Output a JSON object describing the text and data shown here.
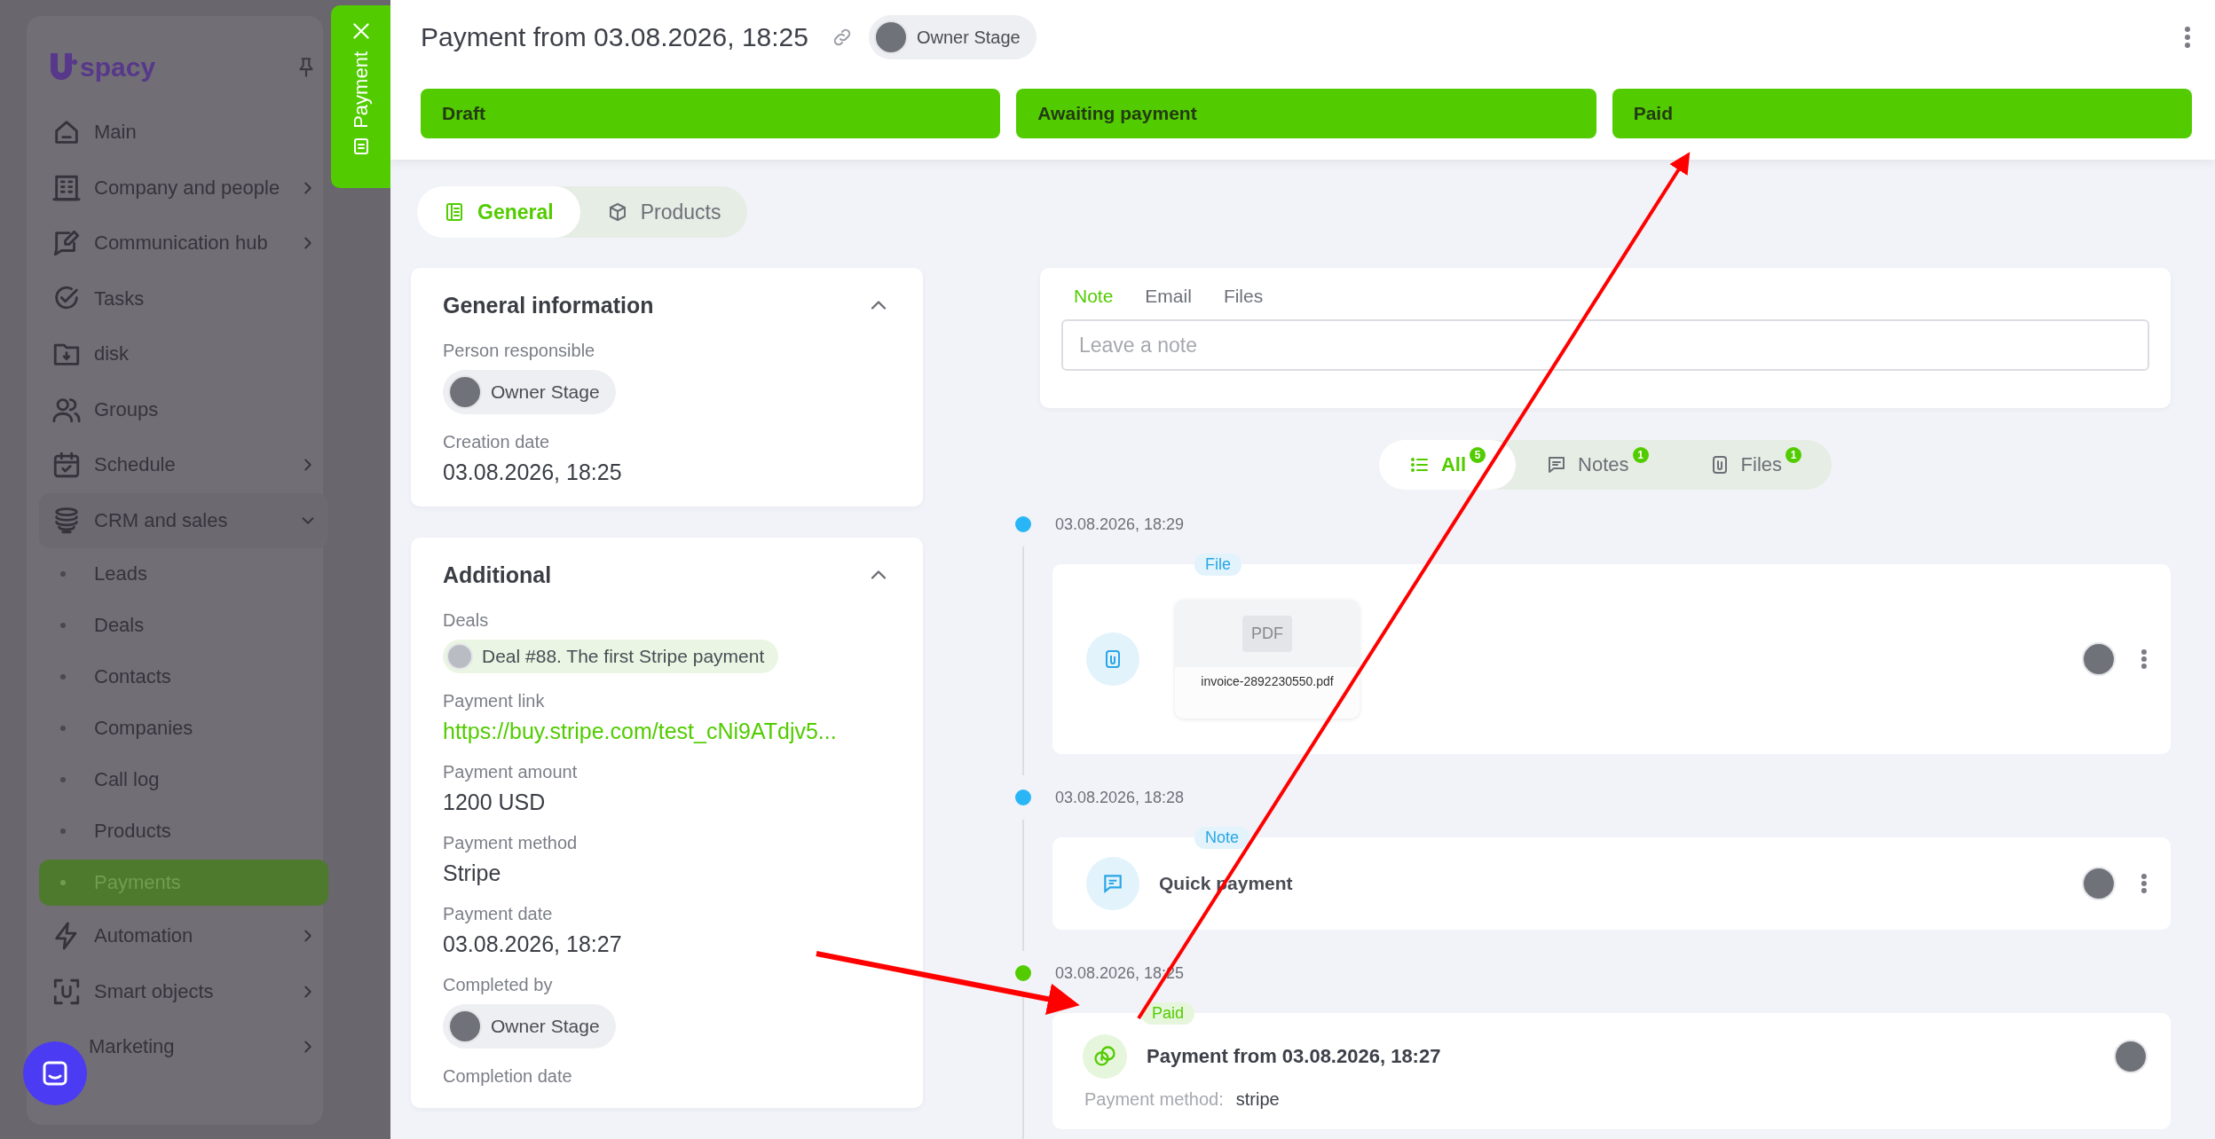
{
  "sidebar": {
    "logo": "spacy",
    "items": [
      {
        "label": "Main",
        "kind": "link",
        "selected": false
      },
      {
        "label": "Company and people",
        "kind": "group",
        "expanded": false,
        "selected": false
      },
      {
        "label": "Communication hub",
        "kind": "group",
        "expanded": false,
        "selected": false
      },
      {
        "label": "Tasks",
        "kind": "link",
        "selected": false
      },
      {
        "label": "disk",
        "kind": "link",
        "selected": false
      },
      {
        "label": "Groups",
        "kind": "link",
        "selected": false
      },
      {
        "label": "Schedule",
        "kind": "group",
        "expanded": false,
        "selected": false
      },
      {
        "label": "CRM and sales",
        "kind": "group",
        "expanded": true,
        "selected": false,
        "children": [
          {
            "label": "Leads",
            "selected": false
          },
          {
            "label": "Deals",
            "selected": false
          },
          {
            "label": "Contacts",
            "selected": false
          },
          {
            "label": "Companies",
            "selected": false
          },
          {
            "label": "Call log",
            "selected": false
          },
          {
            "label": "Products",
            "selected": false
          },
          {
            "label": "Payments",
            "selected": true
          }
        ]
      },
      {
        "label": "Automation",
        "kind": "group",
        "expanded": false,
        "selected": false
      },
      {
        "label": "Smart objects",
        "kind": "group",
        "expanded": false,
        "selected": false
      },
      {
        "label": "Marketing",
        "kind": "group",
        "expanded": false,
        "selected": false
      }
    ]
  },
  "panel_tab": {
    "label": "Payment"
  },
  "header": {
    "title": "Payment from 03.08.2026, 18:25",
    "owner": "Owner Stage",
    "stages": [
      {
        "label": "Draft",
        "reached": true
      },
      {
        "label": "Awaiting payment",
        "reached": true
      },
      {
        "label": "Paid",
        "reached": true
      }
    ]
  },
  "tabs": [
    {
      "label": "General",
      "selected": true
    },
    {
      "label": "Products",
      "selected": false
    }
  ],
  "cards": [
    {
      "title": "General information",
      "expanded": true,
      "fields": [
        {
          "label": "Person responsible",
          "value": "Owner Stage",
          "kind": "person"
        },
        {
          "label": "Creation date",
          "value": "03.08.2026, 18:25",
          "kind": "text"
        }
      ]
    },
    {
      "title": "Additional",
      "expanded": true,
      "fields": [
        {
          "label": "Deals",
          "value": "Deal #88. The first Stripe payment",
          "kind": "deal"
        },
        {
          "label": "Payment link",
          "value": "https://buy.stripe.com/test_cNi9ATdjv5...",
          "kind": "link"
        },
        {
          "label": "Payment amount",
          "value": "1200 USD",
          "kind": "text"
        },
        {
          "label": "Payment method",
          "value": "Stripe",
          "kind": "text"
        },
        {
          "label": "Payment date",
          "value": "03.08.2026, 18:27",
          "kind": "text"
        },
        {
          "label": "Completed by",
          "value": "Owner Stage",
          "kind": "person"
        },
        {
          "label": "Completion date",
          "kind": "text"
        }
      ]
    }
  ],
  "composer": {
    "tabs": [
      {
        "label": "Note",
        "selected": true
      },
      {
        "label": "Email",
        "selected": false
      },
      {
        "label": "Files",
        "selected": false
      }
    ],
    "placeholder": "Leave a note"
  },
  "filters": [
    {
      "label": "All",
      "count": "5",
      "selected": true
    },
    {
      "label": "Notes",
      "count": "1",
      "selected": false
    },
    {
      "label": "Files",
      "count": "1",
      "selected": false
    }
  ],
  "timeline": [
    {
      "date": "03.08.2026, 18:29",
      "kind": "file",
      "tag": "File",
      "color": "#29b6f6",
      "file_type": "PDF",
      "file_name": "invoice-2892230550.pdf"
    },
    {
      "date": "03.08.2026, 18:28",
      "kind": "note",
      "tag": "Note",
      "color": "#29b6f6",
      "text": "Quick payment"
    },
    {
      "date": "03.08.2026, 18:25",
      "kind": "payment",
      "tag": "Paid",
      "color": "#52cc00",
      "text": "Payment from 03.08.2026, 18:27",
      "detail_label": "Payment method:",
      "detail_value": "stripe"
    }
  ]
}
